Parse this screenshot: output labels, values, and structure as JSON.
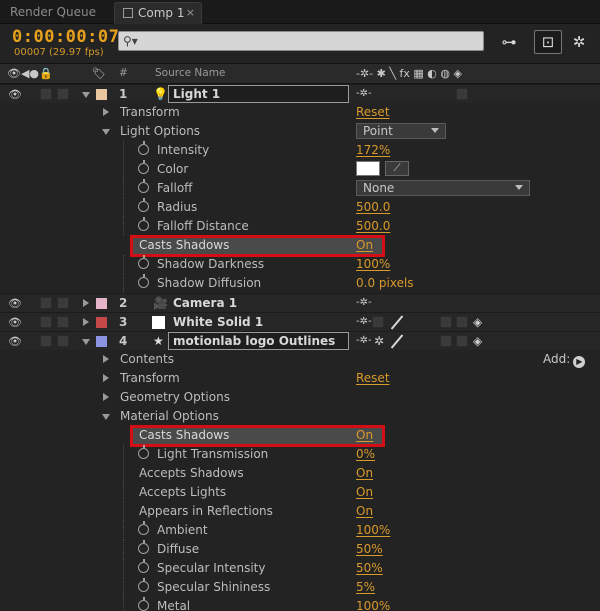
{
  "tabs": [
    {
      "label": "Render Queue"
    },
    {
      "label": "Comp 1",
      "close": "×"
    }
  ],
  "header": {
    "timecode": "0:00:00:07",
    "frames": "00007 (29.97 fps)",
    "search_placeholder": "⚲▾"
  },
  "columns": {
    "number": "#",
    "source_name": "Source Name"
  },
  "symbols": {
    "switches": "-✲- ✱ ╲ fx ▦ ◐ ◍ ◈",
    "eye": "👁",
    "shy": "-✲-"
  },
  "layers": [
    {
      "num": "1",
      "name": "Light 1",
      "label_color": "#e8c7a0"
    },
    {
      "num": "2",
      "name": "Camera 1",
      "label_color": "#e6b4c8"
    },
    {
      "num": "3",
      "name": "White Solid 1",
      "label_color": "#c54848"
    },
    {
      "num": "4",
      "name": "motionlab logo Outlines",
      "label_color": "#8a94e0"
    }
  ],
  "light_props": {
    "transform": "Transform",
    "transform_reset": "Reset",
    "light_options": "Light Options",
    "light_type": "Point",
    "intensity": "Intensity",
    "intensity_val": "172%",
    "color": "Color",
    "falloff": "Falloff",
    "falloff_val": "None",
    "radius": "Radius",
    "radius_val": "500.0",
    "falloff_distance": "Falloff Distance",
    "falloff_distance_val": "500.0",
    "casts_shadows": "Casts Shadows",
    "casts_shadows_val": "On",
    "shadow_darkness": "Shadow Darkness",
    "shadow_darkness_val": "100%",
    "shadow_diffusion": "Shadow Diffusion",
    "shadow_diffusion_val": "0.0 pixels"
  },
  "logo_props": {
    "contents": "Contents",
    "add": "Add:",
    "transform": "Transform",
    "transform_reset": "Reset",
    "geometry_options": "Geometry Options",
    "material_options": "Material Options",
    "casts_shadows": "Casts Shadows",
    "casts_shadows_val": "On",
    "light_transmission": "Light Transmission",
    "light_transmission_val": "0%",
    "accepts_shadows": "Accepts Shadows",
    "accepts_shadows_val": "On",
    "accepts_lights": "Accepts Lights",
    "accepts_lights_val": "On",
    "appears_in_reflections": "Appears in Reflections",
    "appears_in_reflections_val": "On",
    "ambient": "Ambient",
    "ambient_val": "100%",
    "diffuse": "Diffuse",
    "diffuse_val": "50%",
    "specular_intensity": "Specular Intensity",
    "specular_intensity_val": "50%",
    "specular_shininess": "Specular Shininess",
    "specular_shininess_val": "5%",
    "metal": "Metal",
    "metal_val": "100%"
  },
  "colors": {
    "accent": "#e7a11c",
    "highlight_border": "#d40e14"
  }
}
